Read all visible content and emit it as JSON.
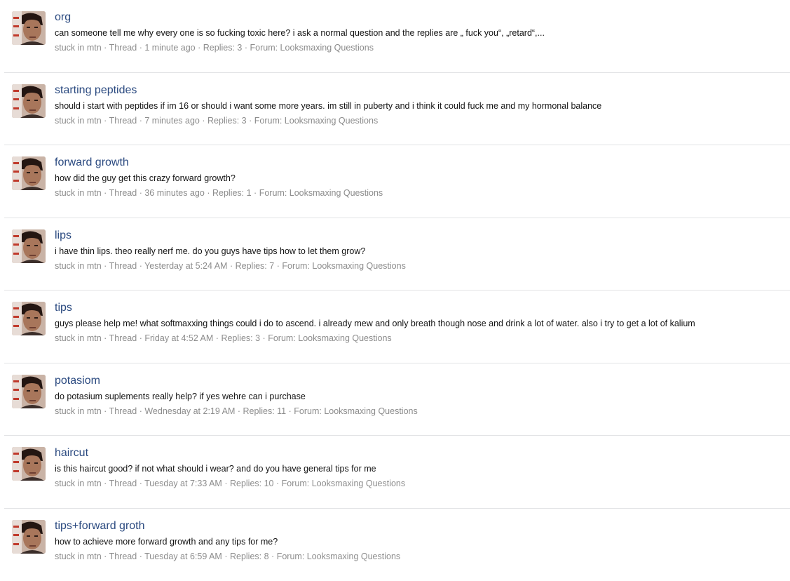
{
  "threads": [
    {
      "title": "org",
      "snippet": "can someone tell me why every one is so fucking toxic here? i ask a normal question and the replies are „ fuck you“, „retard“,...",
      "author": "stuck in mtn",
      "type": "Thread",
      "time": "1 minute ago",
      "replies": "Replies: 3",
      "forum": "Forum: Looksmaxing Questions"
    },
    {
      "title": "starting peptides",
      "snippet": "should i start with peptides if im 16 or should i want some more years. im still in puberty and i think it could fuck me and my hormonal balance",
      "author": "stuck in mtn",
      "type": "Thread",
      "time": "7 minutes ago",
      "replies": "Replies: 3",
      "forum": "Forum: Looksmaxing Questions"
    },
    {
      "title": "forward growth",
      "snippet": "how did the guy get this crazy forward growth?",
      "author": "stuck in mtn",
      "type": "Thread",
      "time": "36 minutes ago",
      "replies": "Replies: 1",
      "forum": "Forum: Looksmaxing Questions"
    },
    {
      "title": "lips",
      "snippet": "i have thin lips. theo really nerf me. do you guys have tips how to let them grow?",
      "author": "stuck in mtn",
      "type": "Thread",
      "time": "Yesterday at 5:24 AM",
      "replies": "Replies: 7",
      "forum": "Forum: Looksmaxing Questions"
    },
    {
      "title": "tips",
      "snippet": "guys please help me! what softmaxxing things could i do to ascend. i already mew and only breath though nose and drink a lot of water. also i try to get a lot of kalium",
      "author": "stuck in mtn",
      "type": "Thread",
      "time": "Friday at 4:52 AM",
      "replies": "Replies: 3",
      "forum": "Forum: Looksmaxing Questions"
    },
    {
      "title": "potasiom",
      "snippet": "do potasium suplements really help? if yes wehre can i purchase",
      "author": "stuck in mtn",
      "type": "Thread",
      "time": "Wednesday at 2:19 AM",
      "replies": "Replies: 11",
      "forum": "Forum: Looksmaxing Questions"
    },
    {
      "title": "haircut",
      "snippet": "is this haircut good? if not what should i wear? and do you have general tips for me",
      "author": "stuck in mtn",
      "type": "Thread",
      "time": "Tuesday at 7:33 AM",
      "replies": "Replies: 10",
      "forum": "Forum: Looksmaxing Questions"
    },
    {
      "title": "tips+forward groth",
      "snippet": "how to achieve more forward growth and any tips for me?",
      "author": "stuck in mtn",
      "type": "Thread",
      "time": "Tuesday at 6:59 AM",
      "replies": "Replies: 8",
      "forum": "Forum: Looksmaxing Questions"
    }
  ],
  "separator": "·",
  "colors": {
    "title_link": "#2b4a80",
    "meta_text": "#8c8c8c",
    "snippet_text": "#141414",
    "divider": "#e2e3e5"
  }
}
